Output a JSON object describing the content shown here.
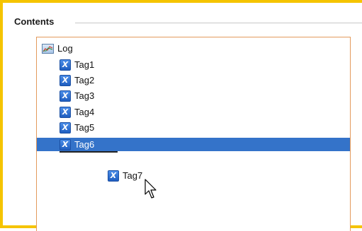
{
  "group": {
    "title": "Contents"
  },
  "tree": {
    "root": {
      "label": "Log",
      "icon": "chart-icon"
    },
    "items": [
      {
        "label": "Tag1",
        "icon": "x-tag-icon"
      },
      {
        "label": "Tag2",
        "icon": "x-tag-icon"
      },
      {
        "label": "Tag3",
        "icon": "x-tag-icon"
      },
      {
        "label": "Tag4",
        "icon": "x-tag-icon"
      },
      {
        "label": "Tag5",
        "icon": "x-tag-icon"
      },
      {
        "label": "Tag6",
        "icon": "x-tag-icon",
        "selected": true
      }
    ],
    "dragging": {
      "label": "Tag7",
      "icon": "x-tag-icon"
    }
  },
  "colors": {
    "frame_border": "#f5c400",
    "tree_border": "#e39a5c",
    "selection": "#3473c9"
  }
}
